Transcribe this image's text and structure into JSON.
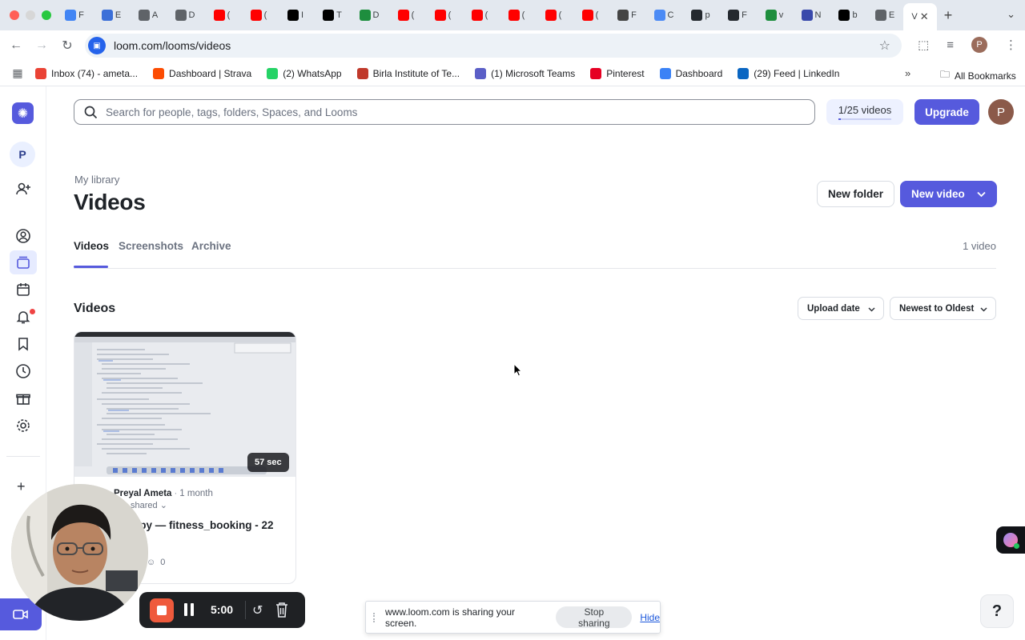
{
  "browser": {
    "tabs": [
      {
        "letter": "F",
        "color": "#4285f4"
      },
      {
        "letter": "E",
        "color": "#3b6fd8"
      },
      {
        "letter": "A",
        "color": "#5f6368"
      },
      {
        "letter": "D",
        "color": "#5f6368"
      },
      {
        "letter": "(",
        "color": "#ff0000"
      },
      {
        "letter": "(",
        "color": "#ff0000"
      },
      {
        "letter": "I",
        "color": "#000000"
      },
      {
        "letter": "T",
        "color": "#000000"
      },
      {
        "letter": "D",
        "color": "#1e8e3e"
      },
      {
        "letter": "(",
        "color": "#ff0000"
      },
      {
        "letter": "(",
        "color": "#ff0000"
      },
      {
        "letter": "(",
        "color": "#ff0000"
      },
      {
        "letter": "(",
        "color": "#ff0000"
      },
      {
        "letter": "(",
        "color": "#ff0000"
      },
      {
        "letter": "(",
        "color": "#ff0000"
      },
      {
        "letter": "F",
        "color": "#444444"
      },
      {
        "letter": "C",
        "color": "#4c8bf5"
      },
      {
        "letter": "p",
        "color": "#24292f"
      },
      {
        "letter": "F",
        "color": "#24292f"
      },
      {
        "letter": "v",
        "color": "#1e8e3e"
      },
      {
        "letter": "N",
        "color": "#3949ab"
      },
      {
        "letter": "b",
        "color": "#000000"
      },
      {
        "letter": "E",
        "color": "#5f6368"
      }
    ],
    "active_tab": {
      "letter": "V",
      "close": "✕"
    },
    "new_tab": "+",
    "url": "loom.com/looms/videos",
    "profile_initial": "P",
    "bookmarks": [
      {
        "label": "Inbox (74) - ameta...",
        "color": "#ea4335"
      },
      {
        "label": "Dashboard | Strava",
        "color": "#fc4c02"
      },
      {
        "label": "(2) WhatsApp",
        "color": "#25d366"
      },
      {
        "label": "Birla Institute of Te...",
        "color": "#c0392b"
      },
      {
        "label": "(1) Microsoft Teams",
        "color": "#5b5fc7"
      },
      {
        "label": "Pinterest",
        "color": "#e60023"
      },
      {
        "label": "Dashboard",
        "color": "#3b82f6"
      },
      {
        "label": "(29) Feed | LinkedIn",
        "color": "#0a66c2"
      }
    ],
    "bookmarks_more": "»",
    "all_bookmarks": "All Bookmarks"
  },
  "app": {
    "search": {
      "placeholder": "Search for people, tags, folders, Spaces, and Looms"
    },
    "quota": {
      "label": "1/25 videos",
      "used": 1,
      "total": 25
    },
    "upgrade_label": "Upgrade",
    "user_initial": "P",
    "workspace_initial": "P",
    "breadcrumb": "My library",
    "title": "Videos",
    "new_folder_label": "New folder",
    "new_video_label": "New video",
    "tabs": [
      "Videos",
      "Screenshots",
      "Archive"
    ],
    "video_count": "1 video",
    "section_title": "Videos",
    "sort": {
      "upload_date": "Upload date",
      "order": "Newest to Oldest"
    },
    "card": {
      "duration": "57 sec",
      "owner": "Preyal Ameta",
      "separator": "·",
      "age": "1 month",
      "shared": "shared",
      "title": "s.py — fitness_booking - 22",
      "reactions": "0"
    }
  },
  "recorder": {
    "time": "5:00"
  },
  "share_bar": {
    "text": "www.loom.com is sharing your screen.",
    "stop_label": "Stop sharing",
    "hide_label": "Hide"
  },
  "help_label": "?",
  "accent_color": "#565add"
}
